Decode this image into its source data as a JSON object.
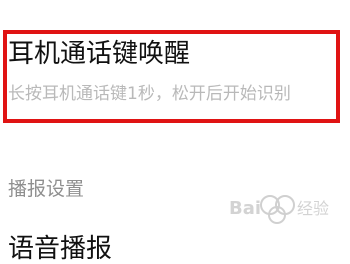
{
  "setting": {
    "title": "耳机通话键唤醒",
    "description": "长按耳机通话键1秒，松开后开始识别"
  },
  "broadcast_section": {
    "header": "播报设置",
    "next_item_label": "语音播报"
  }
}
